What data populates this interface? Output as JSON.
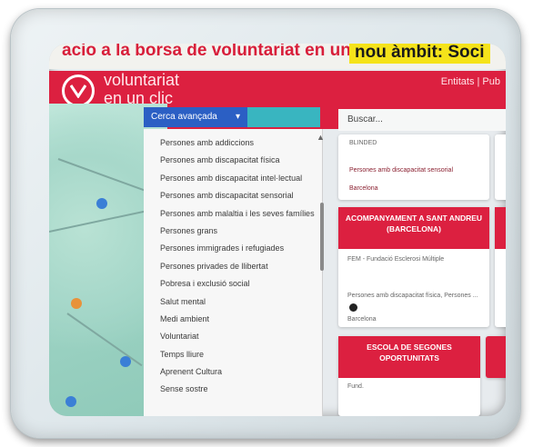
{
  "banner": {
    "red_text": "acio a la borsa de voluntariat en un clic",
    "yellow_text": "nou àmbit: Soci"
  },
  "header": {
    "brand_line1": "voluntariat",
    "brand_line2": "en un clic",
    "links": "Entitats | Pub"
  },
  "search": {
    "advanced_label": "Cerca avançada",
    "caret": "▾",
    "placeholder": "Buscar..."
  },
  "dropdown": {
    "items": [
      "Persones amb addiccions",
      "Persones amb discapacitat física",
      "Persones amb discapacitat intel·lectual",
      "Persones amb discapacitat sensorial",
      "Persones amb malaltia i les seves famílies",
      "Persones grans",
      "Persones immigrades i refugiades",
      "Persones privades de llibertat",
      "Pobresa i exclusió social",
      "Salut mental",
      "Medi ambient",
      "Voluntariat",
      "Temps lliure",
      "Aprenent Cultura",
      "Sense sostre"
    ]
  },
  "cards": {
    "top": {
      "line1": "BLINDED",
      "line2": "Persones amb discapacitat sensorial",
      "line3": "Barcelona"
    },
    "middle": {
      "title": "ACOMPANYAMENT A SANT ANDREU (BARCELONA)",
      "org": "FEM - Fundació Esclerosi Múltiple",
      "tags": "Persones amb discapacitat física, Persones ...",
      "city": "Barcelona"
    },
    "bottom": {
      "title": "ESCOLA DE SEGONES OPORTUNITATS",
      "org": "Fund."
    }
  },
  "colors": {
    "header_red": "#dc2040",
    "search_blue": "#2b5fc4",
    "accent_teal": "#39b5c0",
    "banner_yellow": "#f5e31a"
  }
}
